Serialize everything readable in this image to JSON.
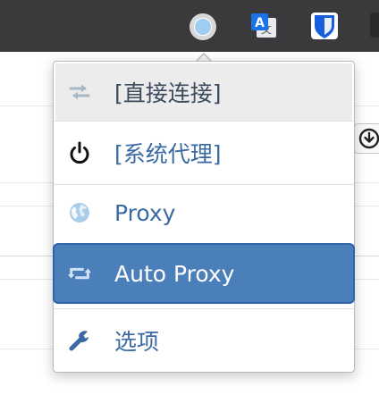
{
  "toolbar": {
    "background": "#3a3a3c",
    "icons": [
      {
        "name": "proxy-switch-icon",
        "accent": "#9fcdf2"
      },
      {
        "name": "translate-icon",
        "accent": "#1a73e8"
      },
      {
        "name": "bitwarden-icon",
        "accent": "#175ddc"
      }
    ]
  },
  "menu": {
    "items": [
      {
        "id": "direct",
        "label": "[直接连接]",
        "icon": "swap-arrows-icon",
        "state": "hover"
      },
      {
        "id": "system",
        "label": "[系统代理]",
        "icon": "power-icon"
      },
      {
        "id": "proxy",
        "label": "Proxy",
        "icon": "globe-icon"
      },
      {
        "id": "auto",
        "label": "Auto Proxy",
        "icon": "retweet-icon",
        "state": "selected"
      },
      {
        "id": "options",
        "label": "选项",
        "icon": "wrench-icon"
      }
    ],
    "accent_color": "#4a7fba",
    "link_color": "#3a6aa3"
  }
}
